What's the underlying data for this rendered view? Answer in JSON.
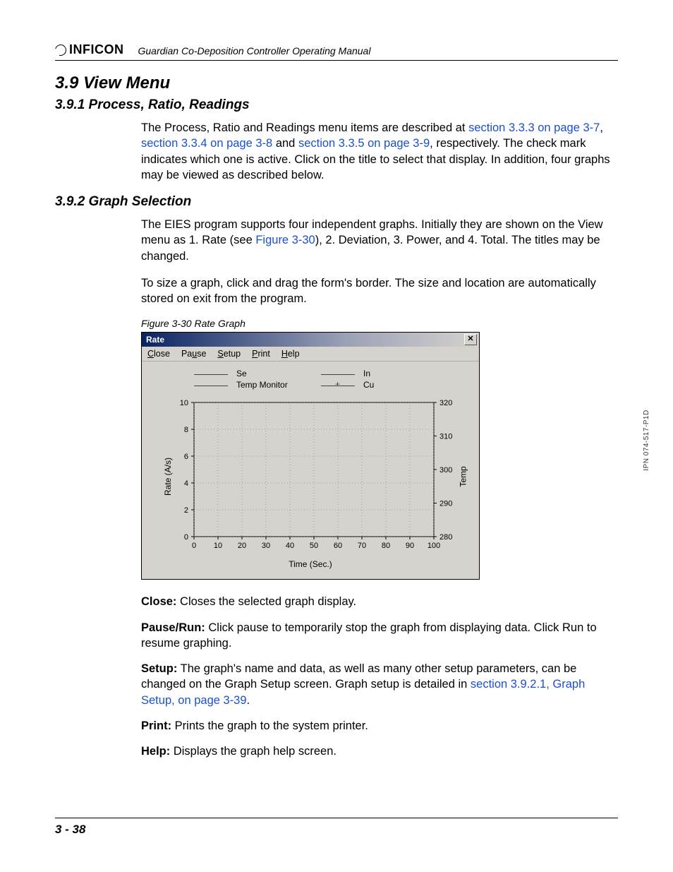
{
  "header": {
    "logo_text": "INFICON",
    "manual_title": "Guardian Co-Deposition Controller Operating Manual"
  },
  "section": {
    "h1": "3.9  View Menu",
    "s1": {
      "title": "3.9.1  Process, Ratio, Readings",
      "p1_a": "The Process, Ratio and Readings menu items are described at ",
      "p1_link1": "section 3.3.3 on page 3-7",
      "p1_b": ", ",
      "p1_link2": "section 3.3.4 on page 3-8",
      "p1_c": " and ",
      "p1_link3": "section 3.3.5 on page 3-9",
      "p1_d": ", respectively. The check mark indicates which one is active. Click on the title to select that display. In addition, four graphs may be viewed as described below."
    },
    "s2": {
      "title": "3.9.2  Graph Selection",
      "p1_a": "The EIES program supports four independent graphs. Initially they are shown on the View menu as 1. Rate (see ",
      "p1_link1": "Figure 3-30",
      "p1_b": "), 2. Deviation, 3. Power, and 4. Total. The titles may be changed.",
      "p2": "To size a graph, click and drag the form's border. The size and location are automatically stored on exit from the program."
    }
  },
  "figure": {
    "caption": "Figure 3-30  Rate Graph",
    "window_title": "Rate",
    "close_glyph": "✕",
    "menu": {
      "close": "Close",
      "pause": "Pause",
      "setup": "Setup",
      "print": "Print",
      "help": "Help"
    },
    "legend": {
      "se": "Se",
      "temp": "Temp Monitor",
      "in": "In",
      "cu": "Cu"
    },
    "ylabel": "Rate (A/s)",
    "y2label": "Temp",
    "xlabel": "Time (Sec.)"
  },
  "chart_data": {
    "type": "line",
    "title": "Rate",
    "xlabel": "Time (Sec.)",
    "ylabel": "Rate (A/s)",
    "y2label": "Temp",
    "xlim": [
      0,
      100
    ],
    "ylim": [
      0,
      10
    ],
    "y2lim": [
      280,
      320
    ],
    "x_ticks": [
      0,
      10,
      20,
      30,
      40,
      50,
      60,
      70,
      80,
      90,
      100
    ],
    "y_ticks": [
      0,
      2,
      4,
      6,
      8,
      10
    ],
    "y2_ticks": [
      280,
      290,
      300,
      310,
      320
    ],
    "series": [
      {
        "name": "Se",
        "axis": "y",
        "values": []
      },
      {
        "name": "Temp Monitor",
        "axis": "y2",
        "values": []
      },
      {
        "name": "In",
        "axis": "y",
        "values": []
      },
      {
        "name": "Cu",
        "axis": "y",
        "values": []
      }
    ]
  },
  "defs": {
    "close_l": "Close:",
    "close_t": " Closes the selected graph display.",
    "pause_l": "Pause/Run:",
    "pause_t": " Click pause to temporarily stop the graph from displaying data. Click Run to resume graphing.",
    "setup_l": "Setup:",
    "setup_t_a": " The graph's name and data, as well as many other setup parameters, can be changed on the Graph Setup screen. Graph setup is detailed in ",
    "setup_link": "section 3.9.2.1, Graph Setup, on page 3-39",
    "setup_t_b": ".",
    "print_l": "Print:",
    "print_t": " Prints the graph to the system printer.",
    "help_l": "Help:",
    "help_t": " Displays the graph help screen."
  },
  "footer": {
    "page": "3 - 38",
    "side": "IPN 074-517-P1D"
  }
}
